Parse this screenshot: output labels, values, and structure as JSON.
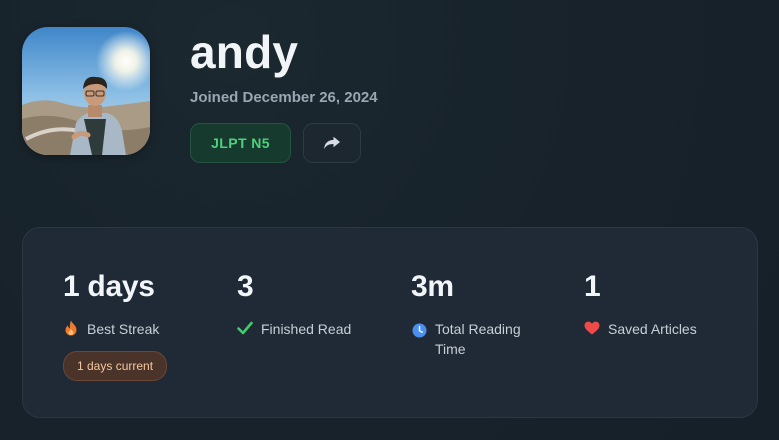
{
  "profile": {
    "username": "andy",
    "joined": "Joined December 26, 2024",
    "level_badge": "JLPT N5"
  },
  "stats": [
    {
      "value": "1 days",
      "label": "Best Streak",
      "icon": "flame-icon",
      "icon_color": "#f07a2a"
    },
    {
      "value": "3",
      "label": "Finished Read",
      "icon": "checkmark-icon",
      "icon_color": "#3ecf6a"
    },
    {
      "value": "3m",
      "label": "Total Reading Time",
      "icon": "clock-icon",
      "icon_color": "#4a8ff0"
    },
    {
      "value": "1",
      "label": "Saved Articles",
      "icon": "heart-icon",
      "icon_color": "#ef4a4a"
    }
  ],
  "streak": {
    "current": "1 days current"
  },
  "colors": {
    "background": "#18232b",
    "card": "#1f2a36",
    "accent_green": "#4fd07c",
    "streak_pill": "#4a3429"
  }
}
